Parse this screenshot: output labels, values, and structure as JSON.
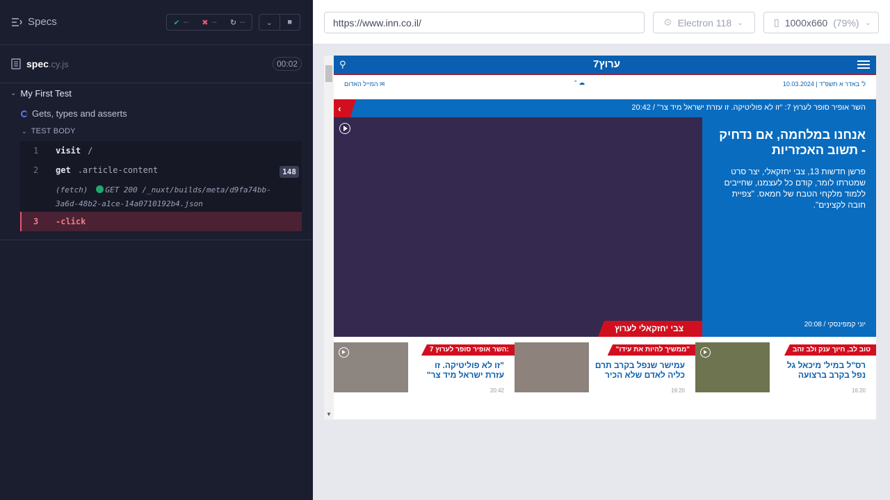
{
  "reporter": {
    "specs_label": "Specs",
    "stats": {
      "passed": "--",
      "failed": "--",
      "pending": "--"
    },
    "spec": {
      "name": "spec",
      "ext": ".cy.js",
      "duration": "00:02"
    },
    "suite_title": "My First Test",
    "test_title": "Gets, types and asserts",
    "test_body_label": "TEST BODY",
    "commands": [
      {
        "num": "1",
        "name": "visit",
        "arg": "/"
      },
      {
        "num": "2",
        "name": "get",
        "arg": ".article-content",
        "count": "148"
      },
      {
        "num": "3",
        "name": "-click"
      }
    ],
    "fetch": {
      "prefix": "(fetch)",
      "text": "GET 200 /_nuxt/builds/meta/d9fa74bb-3a6d-48b2-a1ce-14a0710192b4.json"
    }
  },
  "toolbar": {
    "url": "https://www.inn.co.il/",
    "browser": "Electron 118",
    "viewport": "1000x660",
    "zoom": "(79%)"
  },
  "site": {
    "logo": "ערוץ7",
    "date": "ל' באדר א תשפ\"ד | 10.03.2024",
    "weather": "°",
    "mail_label": "המייל האדום",
    "ticker": {
      "time": "20:42",
      "text": "השר אופיר סופר לערוץ 7: \"זו לא פוליטיקה. זו עזרת ישראל מיד צר\""
    },
    "hero": {
      "title": "אנחנו במלחמה, אם נדחיק - תשוב האכזריות",
      "summary": "פרשן חדשות 13, צבי יחזקאלי, יצר סרט שמטרתו לומר, קודם כל לעצמנו, שחייבים ללמוד מלקחי הטבח של חמאס. \"צפיית חובה לקצינים\".",
      "byline": "יוני קמפינסקי / 20:08",
      "author_tag": "צבי יחזקאלי לערוץ 7:"
    },
    "cards": [
      {
        "cat": "טוב לב, חיוך ענק ולב זהב",
        "title": "רס\"ל במיל' מיכאל גל נפל בקרב ברצועה",
        "meta": "16:20"
      },
      {
        "cat": "\"ממשיך להיות את עידו\"",
        "title": "עמישר שנפל בקרב תרם כליה לאדם שלא הכיר",
        "meta": "19:20"
      },
      {
        "cat": "השר אופיר סופר לערוץ 7:",
        "title": "\"זו לא פוליטיקה. זו עזרת ישראל מיד צר\"",
        "meta": "20:42"
      }
    ]
  }
}
